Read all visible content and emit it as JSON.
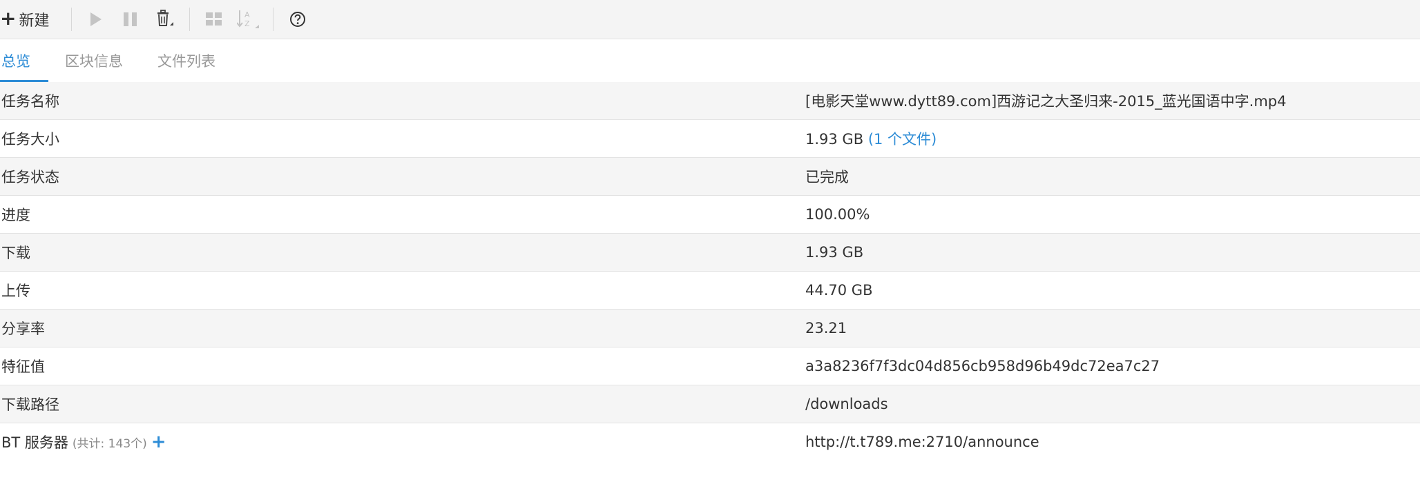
{
  "toolbar": {
    "new_label": "新建",
    "icons": [
      "plus-icon",
      "play-icon",
      "pause-icon",
      "trash-icon",
      "grid-icon",
      "sort-az-icon",
      "help-icon"
    ]
  },
  "tabs": [
    {
      "label": "总览",
      "active": true
    },
    {
      "label": "区块信息",
      "active": false
    },
    {
      "label": "文件列表",
      "active": false
    }
  ],
  "details": {
    "name": {
      "label": "任务名称",
      "value": "[电影天堂www.dytt89.com]西游记之大圣归来-2015_蓝光国语中字.mp4"
    },
    "size": {
      "label": "任务大小",
      "value": "1.93 GB",
      "files_link": "(1 个文件)"
    },
    "status": {
      "label": "任务状态",
      "value": "已完成"
    },
    "progress": {
      "label": "进度",
      "value": "100.00%"
    },
    "download": {
      "label": "下载",
      "value": "1.93 GB"
    },
    "upload": {
      "label": "上传",
      "value": "44.70 GB"
    },
    "ratio": {
      "label": "分享率",
      "value": "23.21"
    },
    "hash": {
      "label": "特征值",
      "value": "a3a8236f7f3dc04d856cb958d96b49dc72ea7c27"
    },
    "path": {
      "label": "下载路径",
      "value": "/downloads"
    },
    "trackers": {
      "label": "BT 服务器",
      "count": "(共计: 143个)",
      "value": "http://t.t789.me:2710/announce"
    }
  },
  "colors": {
    "accent": "#2d8cd6",
    "toolbar_bg": "#f4f4f4",
    "row_alt_bg": "#f5f5f5"
  }
}
